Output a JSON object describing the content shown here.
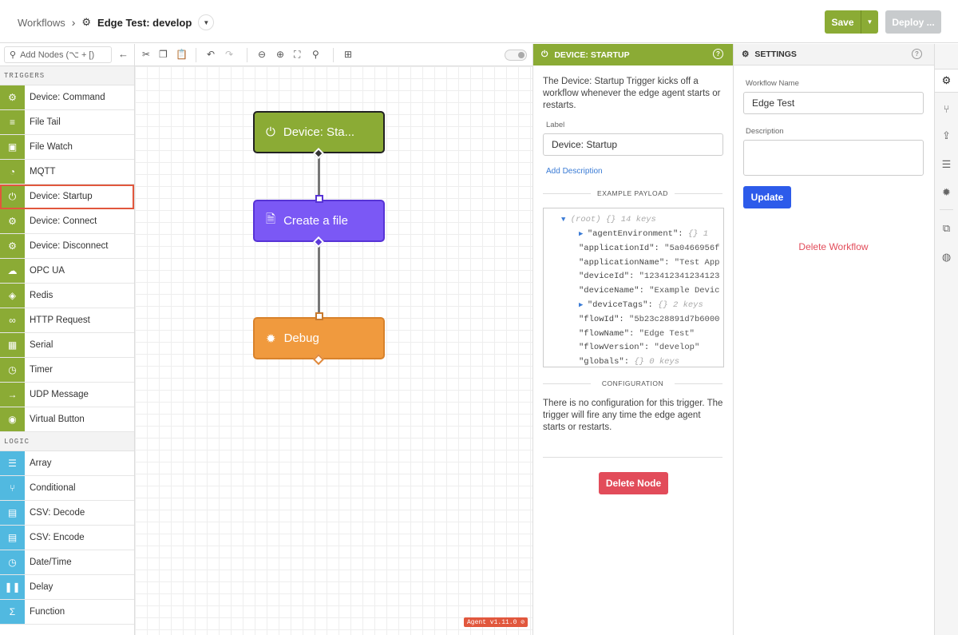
{
  "header": {
    "breadcrumb_root": "Workflows",
    "breadcrumb_sep": "›",
    "workflow_title": "Edge Test: develop",
    "save_label": "Save",
    "deploy_label": "Deploy ..."
  },
  "palette": {
    "search_placeholder": "Add Nodes (⌥ + [)",
    "sections": [
      {
        "title": "TRIGGERS",
        "items": [
          "Device: Command",
          "File Tail",
          "File Watch",
          "MQTT",
          "Device: Startup",
          "Device: Connect",
          "Device: Disconnect",
          "OPC UA",
          "Redis",
          "HTTP Request",
          "Serial",
          "Timer",
          "UDP Message",
          "Virtual Button"
        ]
      },
      {
        "title": "LOGIC",
        "items": [
          "Array",
          "Conditional",
          "CSV: Decode",
          "CSV: Encode",
          "Date/Time",
          "Delay",
          "Function"
        ]
      }
    ],
    "selected_item": "Device: Startup"
  },
  "canvas": {
    "nodes": [
      "Device: Sta...",
      "Create a file",
      "Debug"
    ],
    "version_badge": "Agent v1.11.0"
  },
  "node_panel": {
    "header": "DEVICE: STARTUP",
    "description": "The Device: Startup Trigger kicks off a workflow whenever the edge agent starts or restarts.",
    "label_caption": "Label",
    "label_value": "Device: Startup",
    "add_description": "Add Description",
    "payload_caption": "EXAMPLE PAYLOAD",
    "payload": {
      "root": "(root)",
      "root_meta": "{}  14 keys",
      "lines": [
        {
          "key": "\"agentEnvironment\":",
          "val": "{}  1",
          "expandable": true,
          "meta": true
        },
        {
          "key": "\"applicationId\":",
          "val": "\"5a0466956f",
          "expandable": false,
          "meta": false
        },
        {
          "key": "\"applicationName\":",
          "val": "\"Test App",
          "expandable": false,
          "meta": false
        },
        {
          "key": "\"deviceId\":",
          "val": "\"123412341234123",
          "expandable": false,
          "meta": false
        },
        {
          "key": "\"deviceName\":",
          "val": "\"Example Devic",
          "expandable": false,
          "meta": false
        },
        {
          "key": "\"deviceTags\":",
          "val": "{}  2 keys",
          "expandable": true,
          "meta": true
        },
        {
          "key": "\"flowId\":",
          "val": "\"5b23c28891d7b6000",
          "expandable": false,
          "meta": false
        },
        {
          "key": "\"flowName\":",
          "val": "\"Edge Test\"",
          "expandable": false,
          "meta": false
        },
        {
          "key": "\"flowVersion\":",
          "val": "\"develop\"",
          "expandable": false,
          "meta": false
        },
        {
          "key": "\"globals\":",
          "val": "{}  0 keys",
          "expandable": false,
          "meta": true
        }
      ]
    },
    "config_caption": "CONFIGURATION",
    "config_text": "There is no configuration for this trigger. The trigger will fire any time the edge agent starts or restarts.",
    "delete_node": "Delete Node"
  },
  "settings_panel": {
    "header": "SETTINGS",
    "workflow_name_caption": "Workflow Name",
    "workflow_name_value": "Edge Test",
    "description_caption": "Description",
    "description_value": "",
    "update_label": "Update",
    "delete_workflow": "Delete Workflow"
  },
  "colors": {
    "trigger": "#8bab35",
    "logic": "#51b9e0",
    "create_file_node": "#7b58f5",
    "debug_node": "#f09a3e",
    "danger": "#e24c5a",
    "primary": "#2d5bea"
  }
}
